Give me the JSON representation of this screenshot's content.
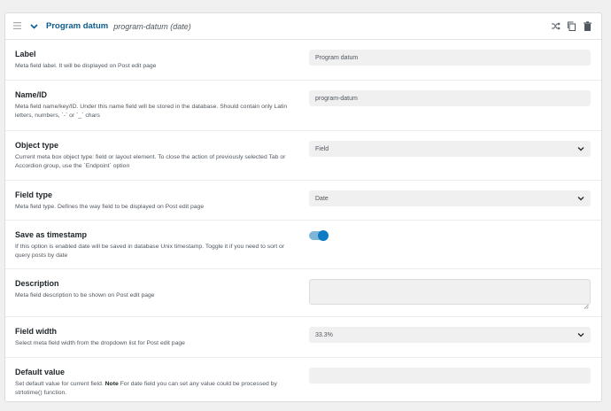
{
  "header": {
    "title": "Program datum",
    "subtitle": "program-datum (date)",
    "icons": [
      "drag-handle-icon",
      "chevron-down-icon",
      "shuffle-icon",
      "copy-icon",
      "trash-icon"
    ]
  },
  "fields": {
    "label": {
      "title": "Label",
      "description": "Meta field label. It will be displayed on Post edit page",
      "value": "Program datum"
    },
    "name": {
      "title": "Name/ID",
      "description": "Meta field name/key/ID. Under this name field will be stored in the database. Should contain only Latin letters, numbers, `-` or `_` chars",
      "value": "program-datum"
    },
    "object_type": {
      "title": "Object type",
      "description": "Current meta box object type: field or layout element. To close the action of previously selected Tab or Accordion group, use the `Endpoint` option",
      "value": "Field"
    },
    "field_type": {
      "title": "Field type",
      "description": "Meta field type. Defines the way field to be displayed on Post edit page",
      "value": "Date"
    },
    "save_timestamp": {
      "title": "Save as timestamp",
      "description": "If this option is enabled date will be saved in database Unix timestamp. Toggle it if you need to sort or query posts by date",
      "enabled": true
    },
    "description": {
      "title": "Description",
      "description": "Meta field description to be shown on Post edit page",
      "value": ""
    },
    "field_width": {
      "title": "Field width",
      "description": "Select meta field width from the dropdown list for Post edit page",
      "value": "33.3%"
    },
    "default_value": {
      "title": "Default value",
      "desc_pre": "Set default value for current field.",
      "desc_note": "Note",
      "desc_post": "For date field you can set any value could be processed by strtotime() function.",
      "value": ""
    }
  },
  "colors": {
    "accent": "#0c5b8f",
    "toggle_on": "#0a7bc4",
    "input_bg": "#f0f0f1"
  }
}
